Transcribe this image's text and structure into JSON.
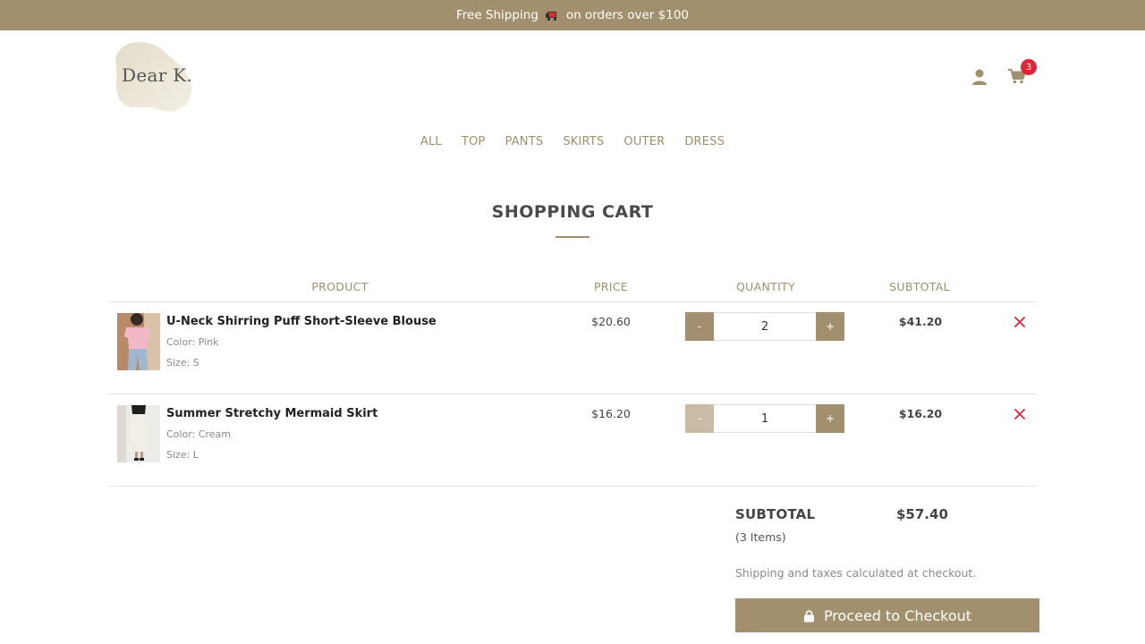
{
  "banner": {
    "text_before": "Free Shipping",
    "icon": "truck-icon",
    "text_after": "on orders over $100"
  },
  "header": {
    "logo_text": "Dear K.",
    "cart_count": "3"
  },
  "nav": [
    "ALL",
    "TOP",
    "PANTS",
    "SKIRTS",
    "OUTER",
    "DRESS"
  ],
  "cart": {
    "title": "SHOPPING CART",
    "columns": {
      "product": "PRODUCT",
      "price": "PRICE",
      "quantity": "QUANTITY",
      "subtotal": "SUBTOTAL"
    },
    "items": [
      {
        "name": "U-Neck Shirring Puff Short-Sleeve Blouse",
        "color": "Color: Pink",
        "size": "Size: S",
        "price": "$20.60",
        "quantity": "2",
        "subtotal": "$41.20",
        "minus": "-",
        "plus": "+"
      },
      {
        "name": "Summer Stretchy Mermaid Skirt",
        "color": "Color: Cream",
        "size": "Size: L",
        "price": "$16.20",
        "quantity": "1",
        "subtotal": "$16.20",
        "minus": "-",
        "plus": "+"
      }
    ],
    "summary": {
      "label": "SUBTOTAL",
      "value": "$57.40",
      "items": "(3 Items)",
      "note": "Shipping and taxes calculated at checkout.",
      "checkout": "Proceed to Checkout"
    }
  },
  "colors": {
    "brand": "#a18f6d",
    "remove": "#e0243c",
    "badge": "#e0243c"
  }
}
